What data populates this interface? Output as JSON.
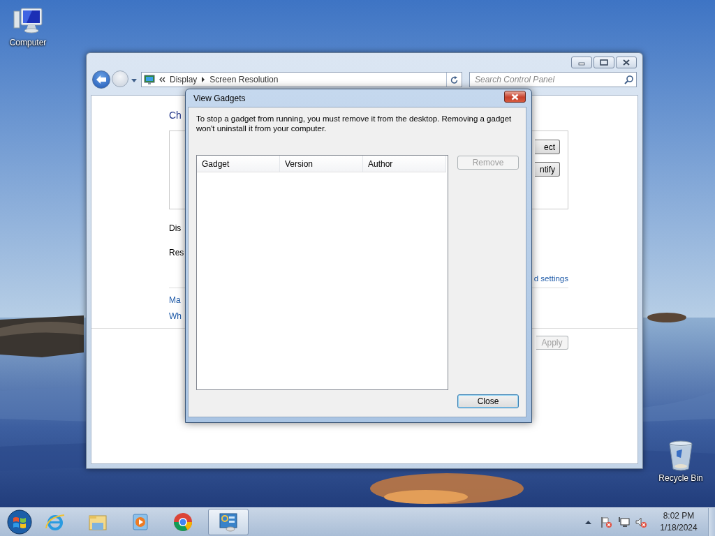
{
  "desktop": {
    "icons": [
      {
        "kind": "computer",
        "label": "Computer"
      },
      {
        "kind": "recycle_bin",
        "label": "Recycle Bin"
      }
    ]
  },
  "control_panel_window": {
    "address_path": [
      "Display",
      "Screen Resolution"
    ],
    "search": {
      "placeholder": "Search Control Panel"
    },
    "heading": "Ch",
    "box_buttons": [
      {
        "label": "ect"
      },
      {
        "label": "ntify"
      }
    ],
    "labels": [
      "Dis",
      "Res"
    ],
    "settings_link": "d settings",
    "links": [
      "Ma",
      "Wh"
    ],
    "apply_button": {
      "label": "Apply",
      "disabled": true
    }
  },
  "dialog": {
    "title": "View Gadgets",
    "message": "To stop a gadget from running, you must remove it from the desktop. Removing a gadget won't uninstall it from your computer.",
    "table": {
      "columns": [
        "Gadget",
        "Version",
        "Author"
      ]
    },
    "buttons": [
      {
        "label": "Remove",
        "disabled": true,
        "focused": false
      },
      {
        "label": "Close",
        "disabled": false,
        "focused": true
      }
    ]
  },
  "taskbar": {
    "apps": [
      {
        "kind": "ie",
        "selected": false
      },
      {
        "kind": "explorer",
        "selected": false
      },
      {
        "kind": "media_player",
        "selected": false
      },
      {
        "kind": "chrome",
        "selected": false
      },
      {
        "kind": "control_panel",
        "selected": true
      }
    ],
    "tray": [
      {
        "kind": "flag_error"
      },
      {
        "kind": "network"
      },
      {
        "kind": "speaker_muted"
      }
    ],
    "clock": {
      "time": "8:02 PM",
      "date": "1/18/2024"
    }
  }
}
